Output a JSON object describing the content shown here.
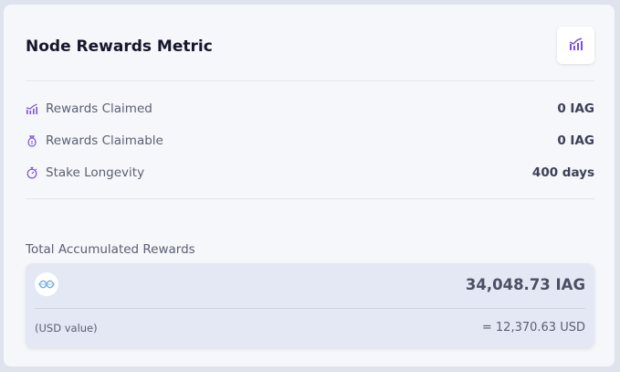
{
  "card": {
    "title": "Node Rewards Metric",
    "chart_button_icon": "bar-chart-icon"
  },
  "metrics": [
    {
      "icon": "bar-chart-icon",
      "label": "Rewards Claimed",
      "value": "0 IAG"
    },
    {
      "icon": "money-bag-icon",
      "label": "Rewards Claimable",
      "value": "0 IAG"
    },
    {
      "icon": "stopwatch-icon",
      "label": "Stake Longevity",
      "value": "400 days"
    }
  ],
  "accumulated": {
    "label": "Total Accumulated Rewards",
    "token_icon": "token-logo-icon",
    "amount": "34,048.73 IAG",
    "usd_label": "(USD value)",
    "usd_value": "= 12,370.63 USD"
  },
  "colors": {
    "accent": "#7b4fd6",
    "card_bg": "#f6f7fa",
    "page_bg": "#dfe3ee",
    "box_bg": "#e4e8f4"
  }
}
